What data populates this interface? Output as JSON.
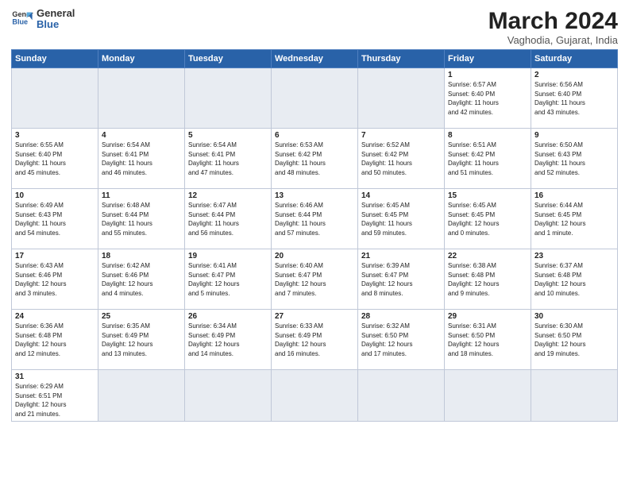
{
  "header": {
    "logo_line1": "General",
    "logo_line2": "Blue",
    "month_year": "March 2024",
    "location": "Vaghodia, Gujarat, India"
  },
  "days_of_week": [
    "Sunday",
    "Monday",
    "Tuesday",
    "Wednesday",
    "Thursday",
    "Friday",
    "Saturday"
  ],
  "weeks": [
    [
      {
        "day": "",
        "info": ""
      },
      {
        "day": "",
        "info": ""
      },
      {
        "day": "",
        "info": ""
      },
      {
        "day": "",
        "info": ""
      },
      {
        "day": "",
        "info": ""
      },
      {
        "day": "1",
        "info": "Sunrise: 6:57 AM\nSunset: 6:40 PM\nDaylight: 11 hours\nand 42 minutes."
      },
      {
        "day": "2",
        "info": "Sunrise: 6:56 AM\nSunset: 6:40 PM\nDaylight: 11 hours\nand 43 minutes."
      }
    ],
    [
      {
        "day": "3",
        "info": "Sunrise: 6:55 AM\nSunset: 6:40 PM\nDaylight: 11 hours\nand 45 minutes."
      },
      {
        "day": "4",
        "info": "Sunrise: 6:54 AM\nSunset: 6:41 PM\nDaylight: 11 hours\nand 46 minutes."
      },
      {
        "day": "5",
        "info": "Sunrise: 6:54 AM\nSunset: 6:41 PM\nDaylight: 11 hours\nand 47 minutes."
      },
      {
        "day": "6",
        "info": "Sunrise: 6:53 AM\nSunset: 6:42 PM\nDaylight: 11 hours\nand 48 minutes."
      },
      {
        "day": "7",
        "info": "Sunrise: 6:52 AM\nSunset: 6:42 PM\nDaylight: 11 hours\nand 50 minutes."
      },
      {
        "day": "8",
        "info": "Sunrise: 6:51 AM\nSunset: 6:42 PM\nDaylight: 11 hours\nand 51 minutes."
      },
      {
        "day": "9",
        "info": "Sunrise: 6:50 AM\nSunset: 6:43 PM\nDaylight: 11 hours\nand 52 minutes."
      }
    ],
    [
      {
        "day": "10",
        "info": "Sunrise: 6:49 AM\nSunset: 6:43 PM\nDaylight: 11 hours\nand 54 minutes."
      },
      {
        "day": "11",
        "info": "Sunrise: 6:48 AM\nSunset: 6:44 PM\nDaylight: 11 hours\nand 55 minutes."
      },
      {
        "day": "12",
        "info": "Sunrise: 6:47 AM\nSunset: 6:44 PM\nDaylight: 11 hours\nand 56 minutes."
      },
      {
        "day": "13",
        "info": "Sunrise: 6:46 AM\nSunset: 6:44 PM\nDaylight: 11 hours\nand 57 minutes."
      },
      {
        "day": "14",
        "info": "Sunrise: 6:45 AM\nSunset: 6:45 PM\nDaylight: 11 hours\nand 59 minutes."
      },
      {
        "day": "15",
        "info": "Sunrise: 6:45 AM\nSunset: 6:45 PM\nDaylight: 12 hours\nand 0 minutes."
      },
      {
        "day": "16",
        "info": "Sunrise: 6:44 AM\nSunset: 6:45 PM\nDaylight: 12 hours\nand 1 minute."
      }
    ],
    [
      {
        "day": "17",
        "info": "Sunrise: 6:43 AM\nSunset: 6:46 PM\nDaylight: 12 hours\nand 3 minutes."
      },
      {
        "day": "18",
        "info": "Sunrise: 6:42 AM\nSunset: 6:46 PM\nDaylight: 12 hours\nand 4 minutes."
      },
      {
        "day": "19",
        "info": "Sunrise: 6:41 AM\nSunset: 6:47 PM\nDaylight: 12 hours\nand 5 minutes."
      },
      {
        "day": "20",
        "info": "Sunrise: 6:40 AM\nSunset: 6:47 PM\nDaylight: 12 hours\nand 7 minutes."
      },
      {
        "day": "21",
        "info": "Sunrise: 6:39 AM\nSunset: 6:47 PM\nDaylight: 12 hours\nand 8 minutes."
      },
      {
        "day": "22",
        "info": "Sunrise: 6:38 AM\nSunset: 6:48 PM\nDaylight: 12 hours\nand 9 minutes."
      },
      {
        "day": "23",
        "info": "Sunrise: 6:37 AM\nSunset: 6:48 PM\nDaylight: 12 hours\nand 10 minutes."
      }
    ],
    [
      {
        "day": "24",
        "info": "Sunrise: 6:36 AM\nSunset: 6:48 PM\nDaylight: 12 hours\nand 12 minutes."
      },
      {
        "day": "25",
        "info": "Sunrise: 6:35 AM\nSunset: 6:49 PM\nDaylight: 12 hours\nand 13 minutes."
      },
      {
        "day": "26",
        "info": "Sunrise: 6:34 AM\nSunset: 6:49 PM\nDaylight: 12 hours\nand 14 minutes."
      },
      {
        "day": "27",
        "info": "Sunrise: 6:33 AM\nSunset: 6:49 PM\nDaylight: 12 hours\nand 16 minutes."
      },
      {
        "day": "28",
        "info": "Sunrise: 6:32 AM\nSunset: 6:50 PM\nDaylight: 12 hours\nand 17 minutes."
      },
      {
        "day": "29",
        "info": "Sunrise: 6:31 AM\nSunset: 6:50 PM\nDaylight: 12 hours\nand 18 minutes."
      },
      {
        "day": "30",
        "info": "Sunrise: 6:30 AM\nSunset: 6:50 PM\nDaylight: 12 hours\nand 19 minutes."
      }
    ],
    [
      {
        "day": "31",
        "info": "Sunrise: 6:29 AM\nSunset: 6:51 PM\nDaylight: 12 hours\nand 21 minutes."
      },
      {
        "day": "",
        "info": ""
      },
      {
        "day": "",
        "info": ""
      },
      {
        "day": "",
        "info": ""
      },
      {
        "day": "",
        "info": ""
      },
      {
        "day": "",
        "info": ""
      },
      {
        "day": "",
        "info": ""
      }
    ]
  ]
}
